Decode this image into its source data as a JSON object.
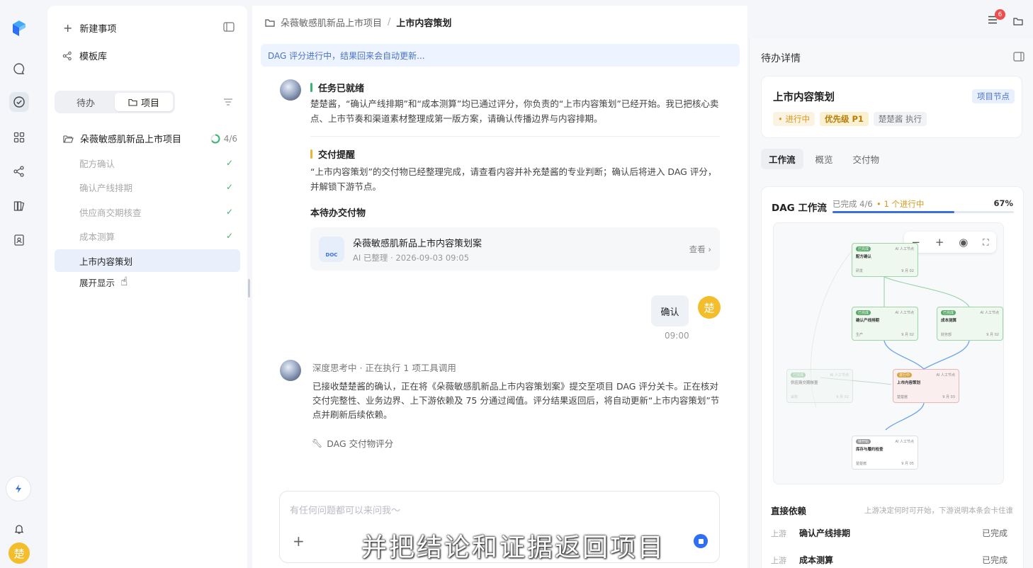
{
  "sidebar": {
    "new_item": "新建事项",
    "templates": "模板库",
    "segment": [
      "待办",
      "项目"
    ],
    "project": {
      "name": "朵薇敏感肌新品上市项目",
      "count": "4/6",
      "progress": 0.67
    },
    "tasks": [
      {
        "label": "配方确认",
        "done": true
      },
      {
        "label": "确认产线排期",
        "done": true
      },
      {
        "label": "供应商交期核查",
        "done": true
      },
      {
        "label": "成本测算",
        "done": true
      },
      {
        "label": "上市内容策划",
        "done": false,
        "selected": true
      },
      {
        "label": "展开显示",
        "done": false
      }
    ]
  },
  "rail": {
    "user_initial": "楚"
  },
  "header": {
    "breadcrumb_parent": "朵薇敏感肌新品上市项目",
    "breadcrumb_sep": "/",
    "breadcrumb_current": "上市内容策划",
    "notif_count": "6"
  },
  "chat": {
    "banner": "DAG 评分进行中，结果回来会自动更新...",
    "msg1": {
      "ready_title": "任务已就绪",
      "ready_text": "楚楚酱，“确认产线排期”和“成本测算”均已通过评分，你负责的“上市内容策划”已经开始。我已把核心卖点、上市节奏和渠道素材整理成第一版方案，请确认传播边界与内容排期。",
      "delivery_title": "交付提醒",
      "delivery_text": "“上市内容策划”的交付物已经整理完成，请查看内容并补充楚酱的专业判断；确认后将进入 DAG 评分，并解锁下游节点。",
      "deliverables_title": "本待办交付物",
      "doc_name": "朵薇敏感肌新品上市内容策划案",
      "doc_meta": "AI 已整理 · 2026-09-03 09:05",
      "doc_view": "查看 ›",
      "doc_tag": "DOC"
    },
    "user_msg": {
      "text": "确认",
      "time": "09:00",
      "avatar": "楚"
    },
    "msg2": {
      "status": "深度思考中 · 正在执行 1 项工具调用",
      "text": "已接收楚楚酱的确认，正在将《朵薇敏感肌新品上市内容策划案》提交至项目 DAG 评分关卡。正在核对交付完整性、业务边界、上下游依赖及 75 分通过阈值。评分结果返回后，将自动更新“上市内容策划”节点并刷新后续依赖。",
      "tool": "DAG 交付物评分"
    },
    "input_placeholder": "有任何问题都可以来问我～",
    "subtitle": "并把结论和证据返回项目"
  },
  "detail": {
    "title": "待办详情",
    "task_name": "上市内容策划",
    "node_tag": "项目节点",
    "status": "• 进行中",
    "priority": "优先级 P1",
    "executor": "楚楚酱 执行",
    "tabs": [
      "工作流",
      "概览",
      "交付物"
    ],
    "dag_title": "DAG 工作流",
    "dag_done": "已完成 4/6",
    "dag_running": "• 1 个进行中",
    "dag_percent": "67%",
    "dag_progress": 0.67,
    "nodes": [
      {
        "tag": "已完成",
        "role": "AI 人工节点",
        "name": "配方确认",
        "owner": "研发",
        "date": "9 月 02"
      },
      {
        "tag": "已完成",
        "role": "AI 人工节点",
        "name": "确认产线排期",
        "owner": "生产",
        "date": "9 月 02"
      },
      {
        "tag": "已完成",
        "role": "AI 人工节点",
        "name": "成本测算",
        "owner": "财务部",
        "date": "9 月 02"
      },
      {
        "tag": "已完成",
        "role": "AI 人工节点",
        "name": "供应商交期核查",
        "owner": "采购",
        "date": "9 月 02"
      },
      {
        "tag": "进行中",
        "role": "AI 人工节点",
        "name": "上市内容策划",
        "owner": "楚楚酱",
        "date": "9 月 03"
      },
      {
        "tag": "待开始",
        "role": "AI 人工节点",
        "name": "库存与履约检查",
        "owner": "楚楚酱",
        "date": "9 月 05"
      }
    ],
    "deps_title": "直接依赖",
    "deps_hint": "上游决定何时可开始，下游说明本条会卡住谁",
    "deps": [
      {
        "kind": "上游",
        "name": "确认产线排期",
        "status": "已完成"
      },
      {
        "kind": "上游",
        "name": "成本测算",
        "status": "已完成"
      }
    ]
  }
}
